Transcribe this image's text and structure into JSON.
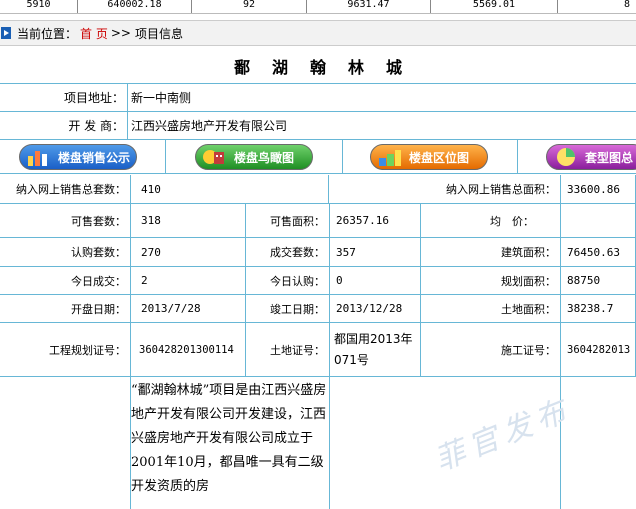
{
  "stats_strip": [
    "5910",
    "640002.18",
    "92",
    "9631.47",
    "5569.01",
    "8"
  ],
  "breadcrumb": {
    "prefix": "当前位置：",
    "home": "首 页",
    "separator": ">>",
    "current": "项目信息"
  },
  "project": {
    "title": "鄱湖翰林城",
    "address_label": "项目地址：",
    "address_value": "新一中南侧",
    "developer_label": "开 发 商：",
    "developer_value": "江西兴盛房地产开发有限公司"
  },
  "buttons": {
    "sales": "楼盘销售公示",
    "aerial": "楼盘鸟瞰图",
    "location": "楼盘区位图",
    "layout": "套型图总"
  },
  "grid": {
    "total_units_label": "纳入网上销售总套数：",
    "total_units_value": "410",
    "total_area_label": "纳入网上销售总面积：",
    "total_area_value": "33600.86",
    "saleable_units_label": "可售套数：",
    "saleable_units_value": "318",
    "saleable_area_label": "可售面积：",
    "saleable_area_value": "26357.16",
    "avg_price_label": "均　价：",
    "avg_price_value": "",
    "subscribed_label": "认购套数：",
    "subscribed_value": "270",
    "deals_label": "成交套数：",
    "deals_value": "357",
    "build_area_label": "建筑面积：",
    "build_area_value": "76450.63",
    "today_deals_label": "今日成交：",
    "today_deals_value": "2",
    "today_sub_label": "今日认购：",
    "today_sub_value": "0",
    "plan_area_label": "规划面积：",
    "plan_area_value": "88750",
    "open_date_label": "开盘日期：",
    "open_date_value": "2013/7/28",
    "finish_date_label": "竣工日期：",
    "finish_date_value": "2013/12/28",
    "land_area_label": "土地面积：",
    "land_area_value": "38238.7",
    "plan_permit_label": "工程规划证号：",
    "plan_permit_value": "360428201300114",
    "land_permit_label": "土地证号：",
    "land_permit_value": "都国用2013年071号",
    "construct_permit_label": "施工证号：",
    "construct_permit_value": "3604282013"
  },
  "description": "“鄱湖翰林城”项目是由江西兴盛房地产开发有限公司开发建设，江西兴盛房地产开发有限公司成立于2001年10月，都昌唯一具有二级开发资质的房",
  "watermark": "菲官发布",
  "colors": {
    "border": "#67b7d6",
    "link_red": "#cc0000",
    "crumb_icon": "#1a5fb4"
  }
}
